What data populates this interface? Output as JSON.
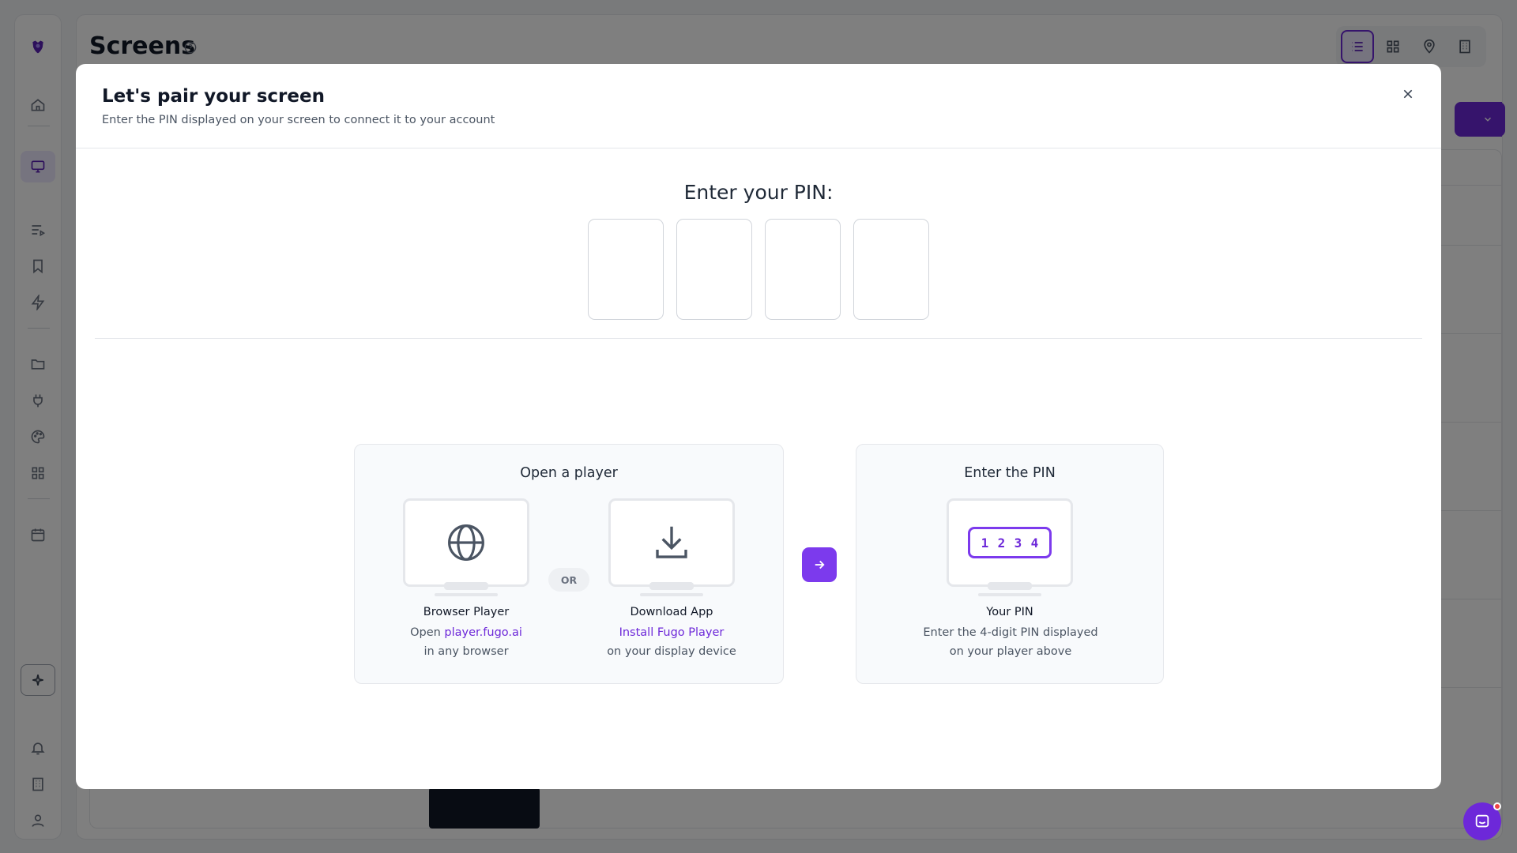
{
  "app": {
    "page_title": "Screens"
  },
  "modal": {
    "title": "Let's pair your screen",
    "subtitle": "Enter the PIN displayed on your screen to connect it to your account",
    "pin_label": "Enter your PIN:",
    "pin_values": [
      "",
      "",
      "",
      ""
    ],
    "open_player": {
      "title": "Open a player",
      "browser": {
        "title": "Browser Player",
        "line1_prefix": "Open ",
        "line1_link": "player.fugo.ai",
        "line2": "in any browser"
      },
      "or_label": "OR",
      "download": {
        "title": "Download App",
        "line1_link": "Install Fugo Player",
        "line2": "on your display device"
      }
    },
    "enter_pin": {
      "title": "Enter the PIN",
      "sample_digits": [
        "1",
        "2",
        "3",
        "4"
      ],
      "your_pin_title": "Your PIN",
      "line1": "Enter the 4-digit PIN displayed",
      "line2": "on your player above"
    }
  },
  "colors": {
    "accent": "#7c3aed",
    "link": "#6d28d9",
    "overlay": "rgba(0,0,0,0.5)",
    "notification_dot": "#ef4444"
  },
  "icons": {
    "sidebar": [
      "logo-icon",
      "home-icon",
      "screens-icon",
      "playlist-icon",
      "bookmark-icon",
      "lightning-icon",
      "folder-icon",
      "plug-icon",
      "palette-icon",
      "apps-icon",
      "calendar-icon",
      "ai-sparkle-icon",
      "bell-icon",
      "building-icon",
      "user-icon"
    ],
    "view_switch": [
      "list-view-icon",
      "grid-view-icon",
      "map-pin-icon",
      "building-view-icon"
    ]
  }
}
